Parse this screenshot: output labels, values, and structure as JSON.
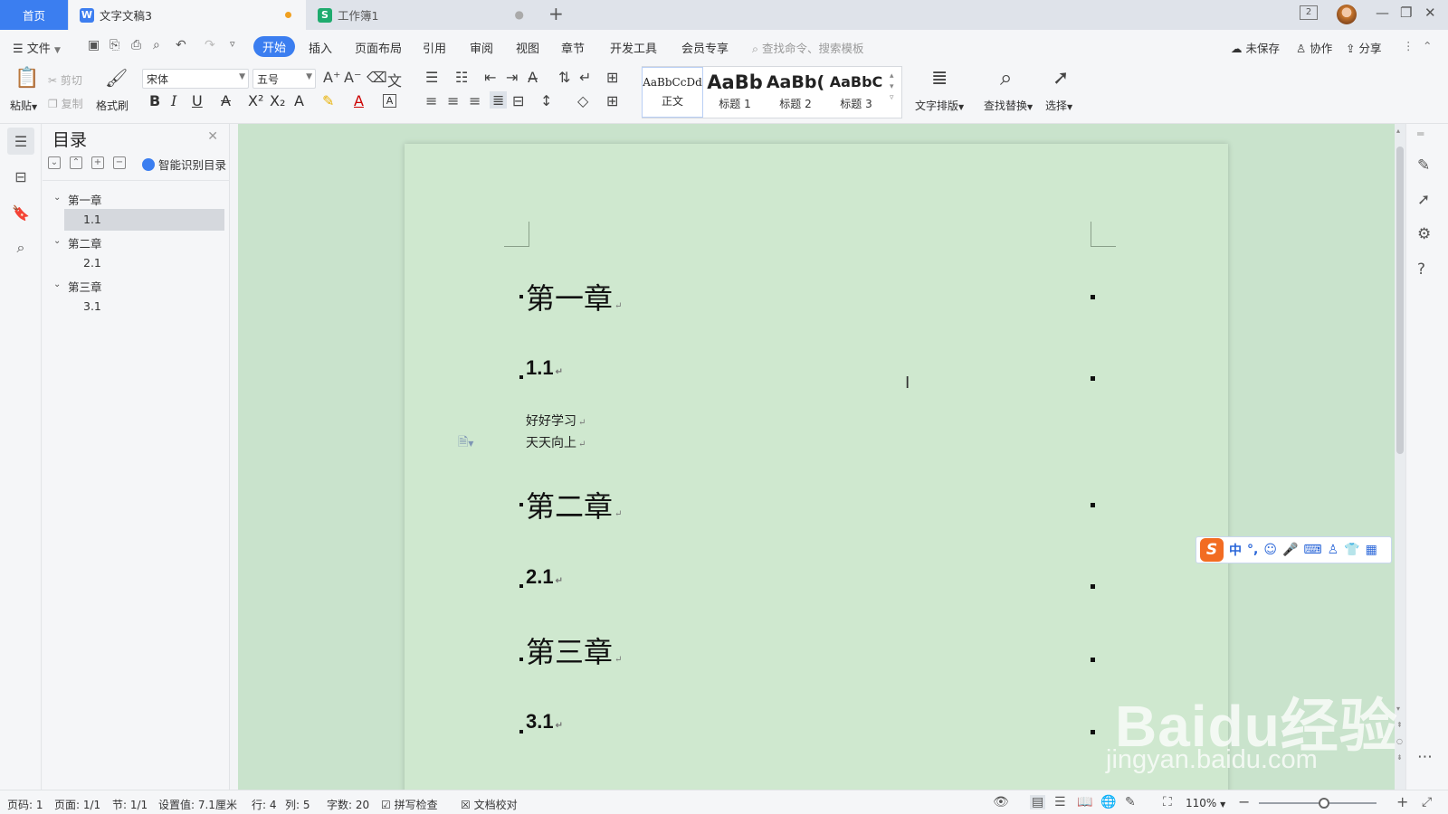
{
  "tabs": {
    "home": "首页",
    "doc": "文字文稿3",
    "sheet": "工作簿1",
    "doc_badge": "W",
    "sheet_badge": "S"
  },
  "window": {
    "badge_count": "2"
  },
  "menu": {
    "file": "文件",
    "start": "开始",
    "items": [
      "插入",
      "页面布局",
      "引用",
      "审阅",
      "视图",
      "章节",
      "开发工具",
      "会员专享"
    ],
    "search_placeholder": "查找命令、搜索模板",
    "unsaved": "未保存",
    "collab": "协作",
    "share": "分享"
  },
  "ribbon": {
    "paste": "粘贴",
    "cut": "剪切",
    "copy": "复制",
    "format_painter": "格式刷",
    "font_name": "宋体",
    "font_size": "五号",
    "styles": [
      {
        "sample": "AaBbCcDd",
        "name": "正文"
      },
      {
        "sample": "AaBb",
        "name": "标题 1"
      },
      {
        "sample": "AaBb(",
        "name": "标题 2"
      },
      {
        "sample": "AaBbC",
        "name": "标题 3"
      }
    ],
    "text_layout": "文字排版",
    "find_replace": "查找替换",
    "select": "选择"
  },
  "toc": {
    "title": "目录",
    "smart": "智能识别目录",
    "items": [
      {
        "label": "第一章",
        "level": 1
      },
      {
        "label": "1.1",
        "level": 2,
        "selected": true
      },
      {
        "label": "第二章",
        "level": 1
      },
      {
        "label": "2.1",
        "level": 2
      },
      {
        "label": "第三章",
        "level": 1
      },
      {
        "label": "3.1",
        "level": 2
      }
    ]
  },
  "document": {
    "h1_1": "第一章",
    "h2_1": "1.1",
    "body_1": "好好学习",
    "body_2": "天天向上",
    "h1_2": "第二章",
    "h2_2": "2.1",
    "h1_3": "第三章",
    "h2_3": "3.1",
    "para_mark": "↵"
  },
  "ime": {
    "lang": "中",
    "punct": "°,"
  },
  "status": {
    "page_code": "页码: 1",
    "pages": "页面: 1/1",
    "section": "节: 1/1",
    "setting": "设置值: 7.1厘米",
    "row": "行: 4",
    "col": "列: 5",
    "words": "字数: 20",
    "spell": "拼写检查",
    "proof": "文档校对",
    "zoom": "110%",
    "zoom_fraction": 0.55
  },
  "watermark": {
    "logo": "Baidu经验",
    "url": "jingyan.baidu.com"
  },
  "colors": {
    "accent": "#3b7ef0",
    "page_bg": "#cfe8cf",
    "workspace_bg": "#c9e3cc"
  }
}
